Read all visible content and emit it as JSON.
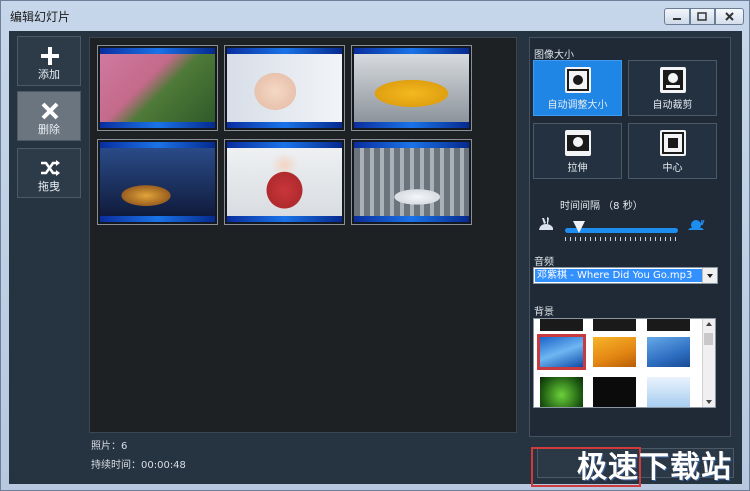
{
  "window": {
    "title": "编辑幻灯片"
  },
  "toolbar": {
    "add_label": "添加",
    "delete_label": "删除",
    "drag_label": "拖曳"
  },
  "gallery": {
    "thumbnails": [
      {
        "subject": "aerial flowers and forest",
        "colors": [
          "#c46a8a",
          "#3f6a33"
        ]
      },
      {
        "subject": "portrait woman",
        "colors": [
          "#dfe6ee",
          "#f3d5c2"
        ]
      },
      {
        "subject": "yellow sports car",
        "colors": [
          "#8a9199",
          "#f1b21b"
        ]
      },
      {
        "subject": "castle at night",
        "colors": [
          "#1d2d58",
          "#c98a2a"
        ]
      },
      {
        "subject": "woman in red dress",
        "colors": [
          "#e5e6e9",
          "#c8363a"
        ]
      },
      {
        "subject": "white car in showroom",
        "colors": [
          "#9aa3ad",
          "#e9ecef"
        ]
      }
    ]
  },
  "info": {
    "photos": "照片：6",
    "duration": "持续时间：00:00:48"
  },
  "panel": {
    "image_size_label": "图像大小",
    "size_options": [
      {
        "label": "自动调整大小",
        "selected": true
      },
      {
        "label": "自动裁剪",
        "selected": false
      },
      {
        "label": "拉伸",
        "selected": false
      },
      {
        "label": "中心",
        "selected": false
      }
    ],
    "interval_label": "时间间隔 （8 秒）",
    "interval_seconds": 8,
    "audio_label": "音频",
    "audio_value": "邓紫棋 - Where Did You Go.mp3",
    "background_label": "背景"
  },
  "watermark": "极速下载站",
  "colors": {
    "accent": "#1f86e6",
    "client_bg": "#263340",
    "highlight": "#d13a3a"
  }
}
